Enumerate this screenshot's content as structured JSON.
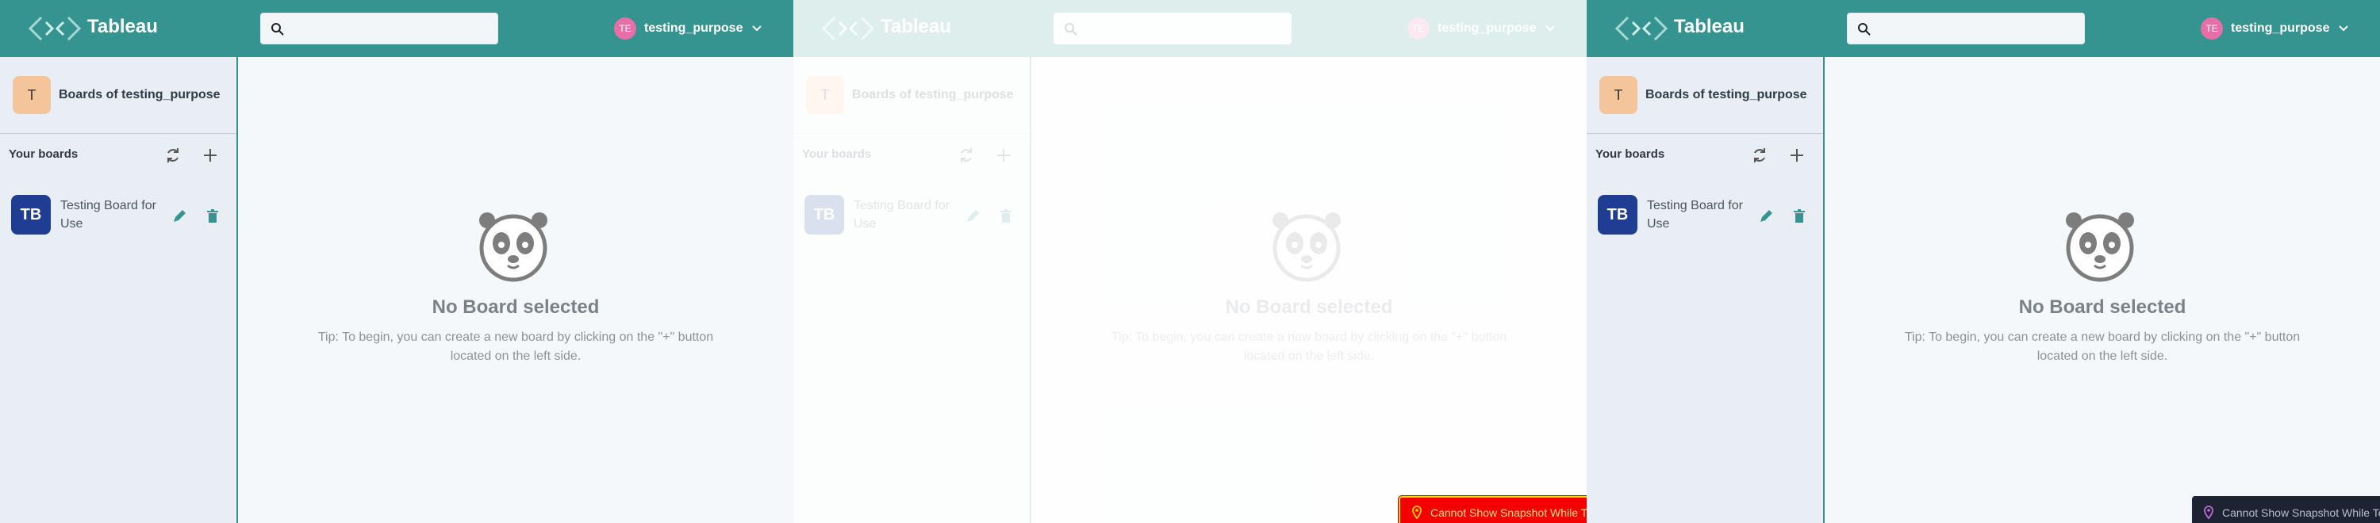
{
  "app": {
    "brand": "Tableau",
    "username": "testing_purpose",
    "user_initials": "TE",
    "search_placeholder": ""
  },
  "sidebar": {
    "org_initial": "T",
    "org_label": "Boards of testing_purpose",
    "boards_title": "Your boards",
    "boards": [
      {
        "initials": "TB",
        "name": "Testing Board for Use"
      }
    ]
  },
  "main": {
    "empty_title": "No Board selected",
    "empty_tip": "Tip: To begin, you can create a new board by clicking on the \"+\" button located on the left side."
  },
  "toast": {
    "message": "Cannot Show Snapshot While Tests Are Running"
  },
  "colors": {
    "header_teal": "#35948f",
    "avatar_pink": "#e76fa9",
    "org_avatar": "#f4c59b",
    "board_avatar": "#1f3d93",
    "toast_dark": "#1d2333",
    "toast_red": "#f40000"
  }
}
